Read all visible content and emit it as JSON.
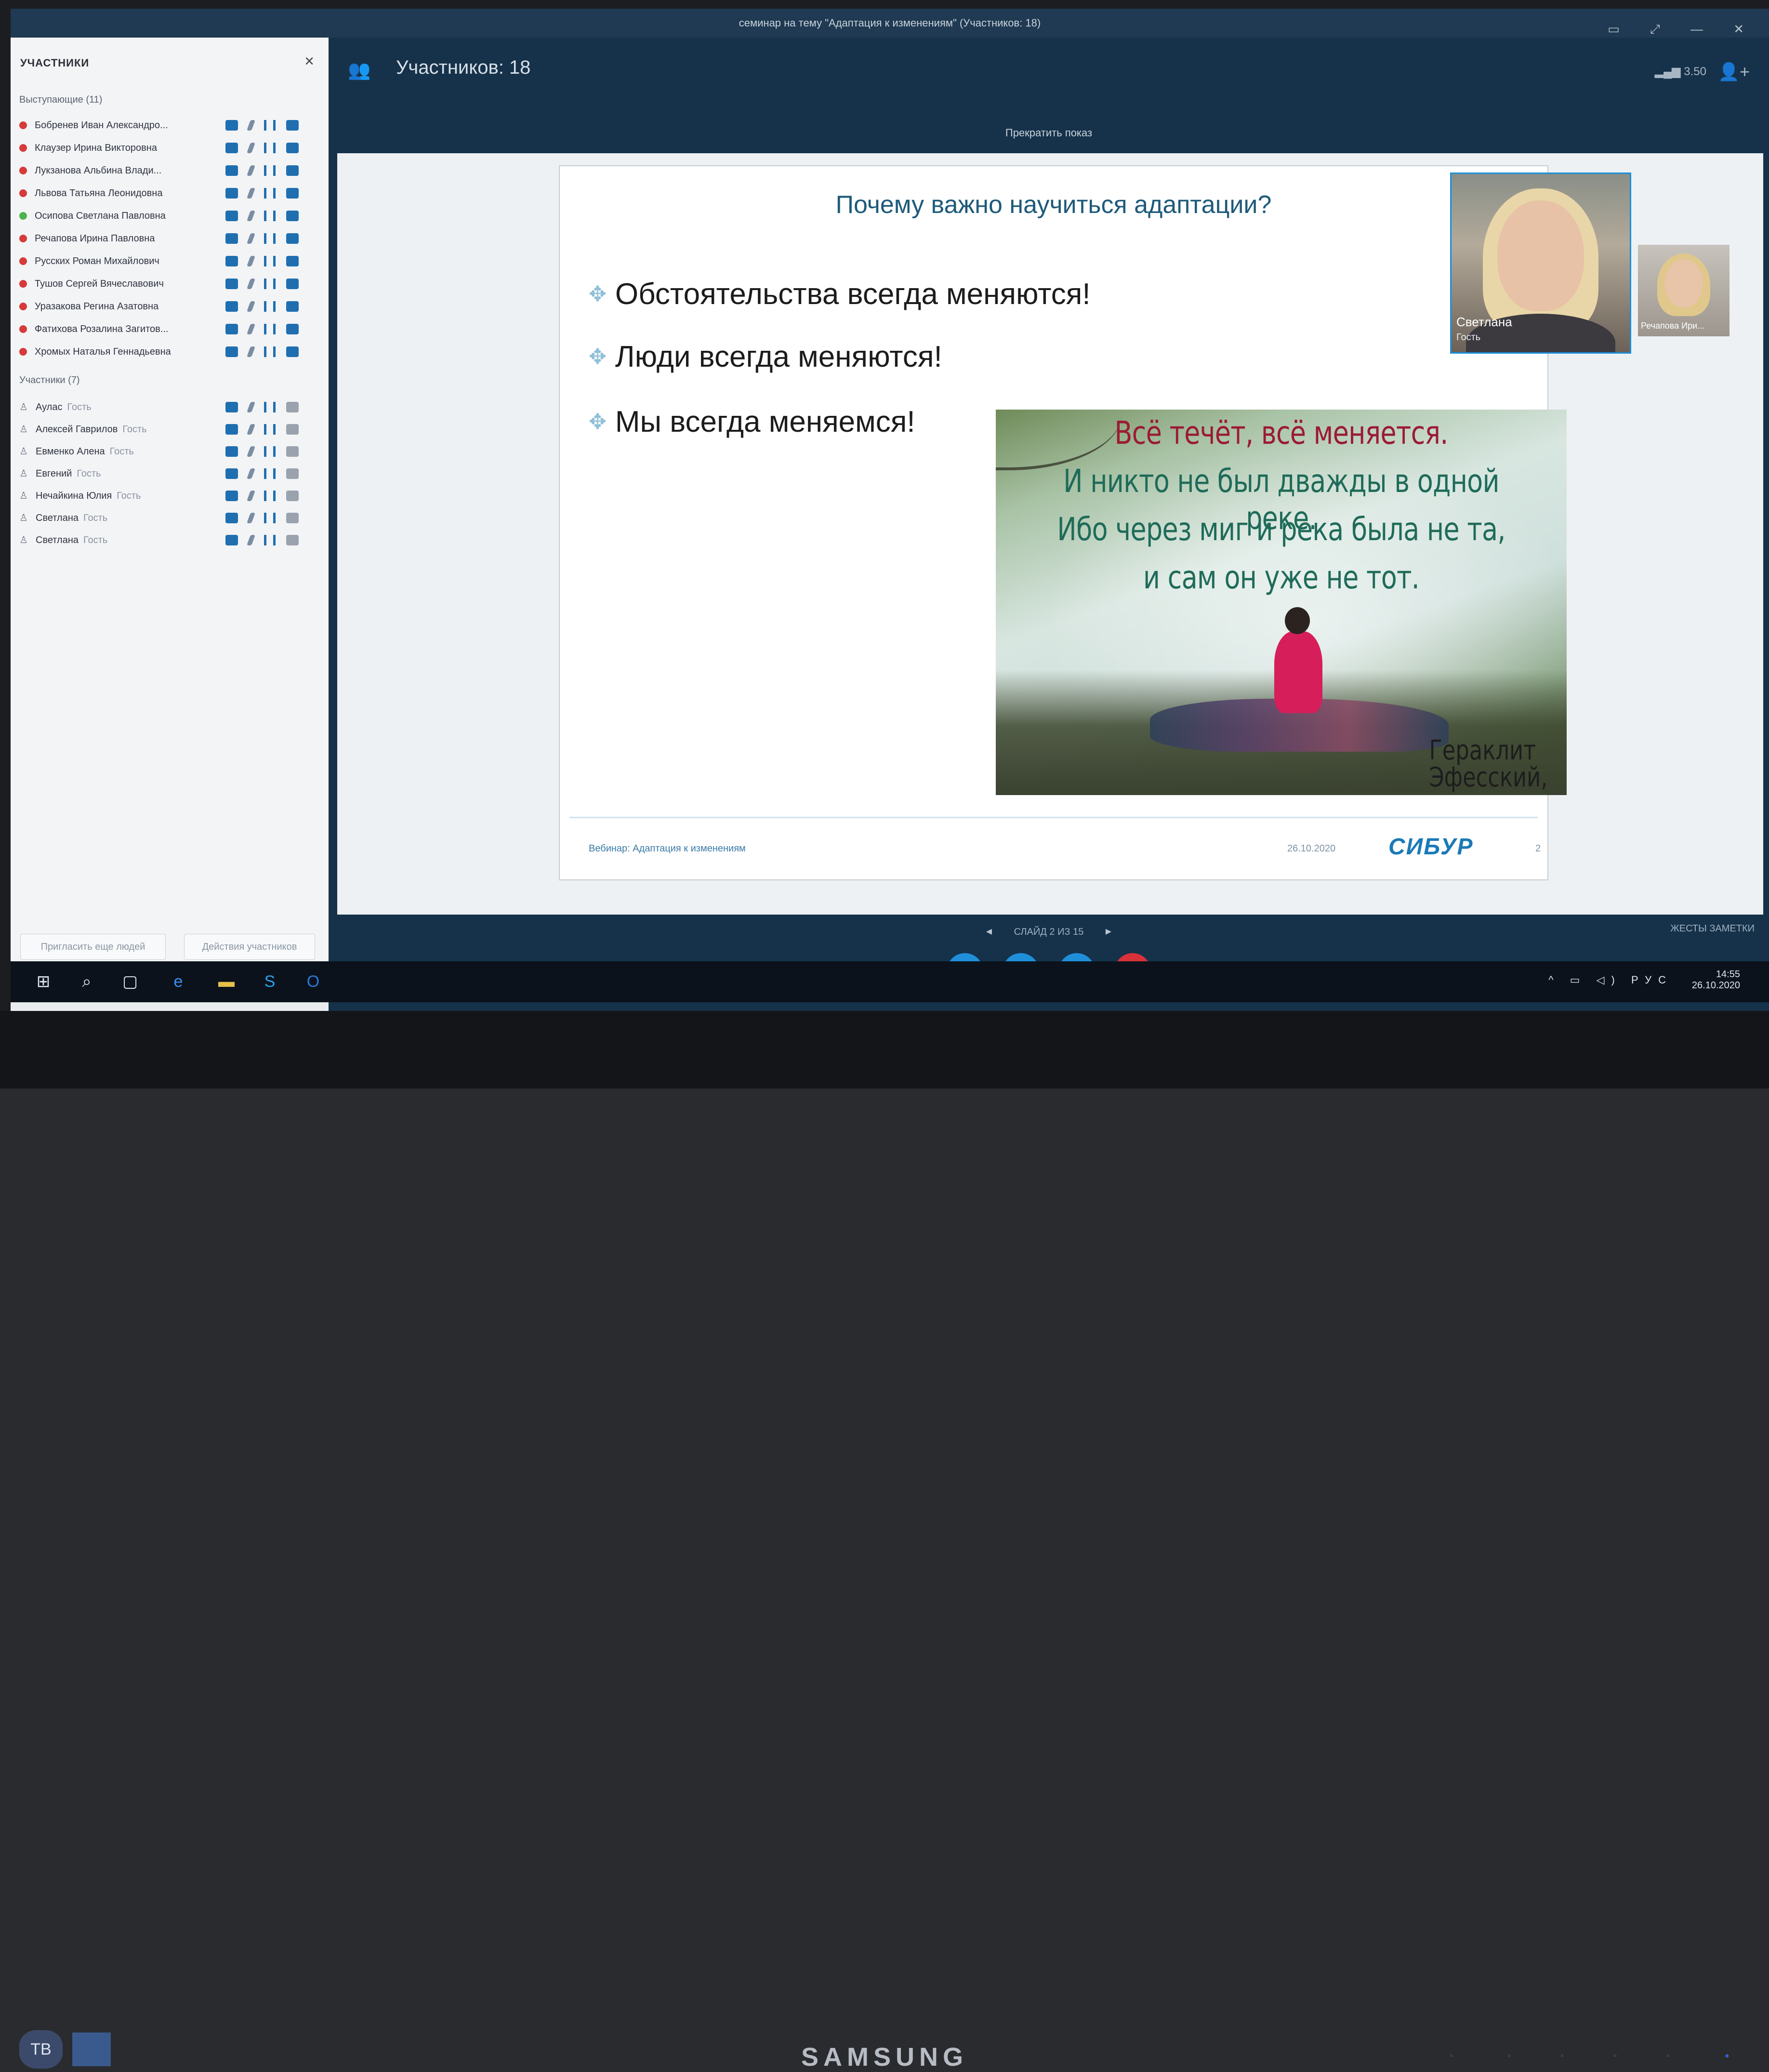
{
  "window": {
    "title": "семинар на тему \"Адаптация к изменениям\" (Участников: 18)"
  },
  "panel": {
    "heading": "УЧАСТНИКИ",
    "close": "×",
    "presenters_label": "Выступающие (11)",
    "presenters": [
      {
        "name": "Бобренев Иван Александро...",
        "status": "red"
      },
      {
        "name": "Клаузер Ирина Викторовна",
        "status": "red"
      },
      {
        "name": "Лукзанова Альбина Влади...",
        "status": "red"
      },
      {
        "name": "Львова Татьяна Леонидовна",
        "status": "red"
      },
      {
        "name": "Осипова Светлана Павловна",
        "status": "green"
      },
      {
        "name": "Речапова Ирина Павловна",
        "status": "red"
      },
      {
        "name": "Русских Роман Михайлович",
        "status": "red"
      },
      {
        "name": "Тушов Сергей Вячеславович",
        "status": "red"
      },
      {
        "name": "Уразакова Регина Азатовна",
        "status": "red"
      },
      {
        "name": "Фатихова Розалина Загитов...",
        "status": "red"
      },
      {
        "name": "Хромых Наталья Геннадьевна",
        "status": "red"
      }
    ],
    "attendees_label": "Участники (7)",
    "attendees": [
      {
        "name": "Аулас",
        "role": "Гость"
      },
      {
        "name": "Алексей Гаврилов",
        "role": "Гость"
      },
      {
        "name": "Евменко Алена",
        "role": "Гость"
      },
      {
        "name": "Евгений",
        "role": "Гость"
      },
      {
        "name": "Нечайкина Юлия",
        "role": "Гость"
      },
      {
        "name": "Светлана",
        "role": "Гость"
      },
      {
        "name": "Светлана",
        "role": "Гость"
      }
    ],
    "invite_button": "Пригласить еще людей",
    "actions_button": "Действия участников"
  },
  "topbar": {
    "participants_count": "Участников: 18",
    "signal": "3.50"
  },
  "stop_sharing": "Прекратить показ",
  "slide": {
    "title": "Почему важно научиться адаптации?",
    "bullets": [
      "Обстоятельства всегда меняются!",
      "Люди всегда меняются!",
      "Мы всегда меняемся!"
    ],
    "quote_lines": [
      "Всё течёт, всё меняется.",
      "И никто не был дважды в одной реке.",
      "Ибо через миг и река была не та,",
      "и сам он уже не тот."
    ],
    "author_line1": "Гераклит",
    "author_line2": "Эфесский,",
    "footer_left": "Вебинар: Адаптация к изменениям",
    "footer_date": "26.10.2020",
    "brand": "СИБУР",
    "page": "2"
  },
  "video": {
    "main_name": "Светлана",
    "main_role": "Гость",
    "small_name": "Речапова Ири..."
  },
  "slide_nav": {
    "label": "СЛАЙД 2 ИЗ 15",
    "prev": "◂",
    "next": "▸",
    "notes": "ЖЕСТЫ  ЗАМЕТКИ"
  },
  "taskbar": {
    "lang": "РУС",
    "time": "14:55",
    "date": "26.10.2020"
  },
  "monitor": {
    "brand": "SAMSUNG",
    "sticker": "TB"
  },
  "colors": {
    "accent": "#1f8fd9",
    "end_call": "#d9313a",
    "sidebar_bg": "#16324a",
    "brand_blue": "#1a7ab7"
  }
}
